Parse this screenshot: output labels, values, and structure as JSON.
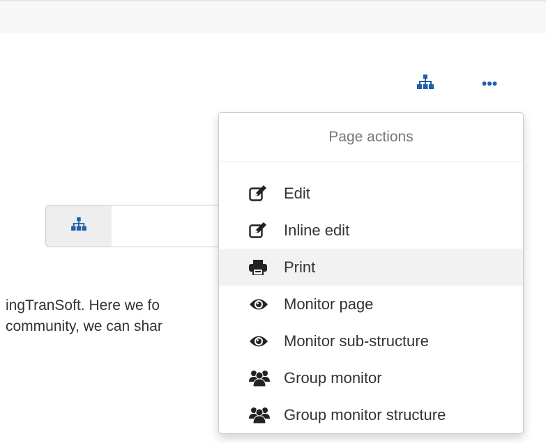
{
  "accent_color": "#1f5fa8",
  "toolbar": {
    "structure_icon": "sitemap-icon",
    "more_icon": "ellipsis-icon"
  },
  "search": {
    "addon_icon": "sitemap-icon",
    "value": ""
  },
  "intro": {
    "line1": "ingTranSoft. Here we fo",
    "line2": "community, we can shar"
  },
  "page_actions": {
    "header": "Page actions",
    "items": [
      {
        "label": "Edit",
        "icon": "edit-icon"
      },
      {
        "label": "Inline edit",
        "icon": "edit-icon"
      },
      {
        "label": "Print",
        "icon": "print-icon"
      },
      {
        "label": "Monitor page",
        "icon": "eye-icon"
      },
      {
        "label": "Monitor sub-structure",
        "icon": "eye-icon"
      },
      {
        "label": "Group monitor",
        "icon": "group-icon"
      },
      {
        "label": "Group monitor structure",
        "icon": "group-icon"
      }
    ]
  }
}
